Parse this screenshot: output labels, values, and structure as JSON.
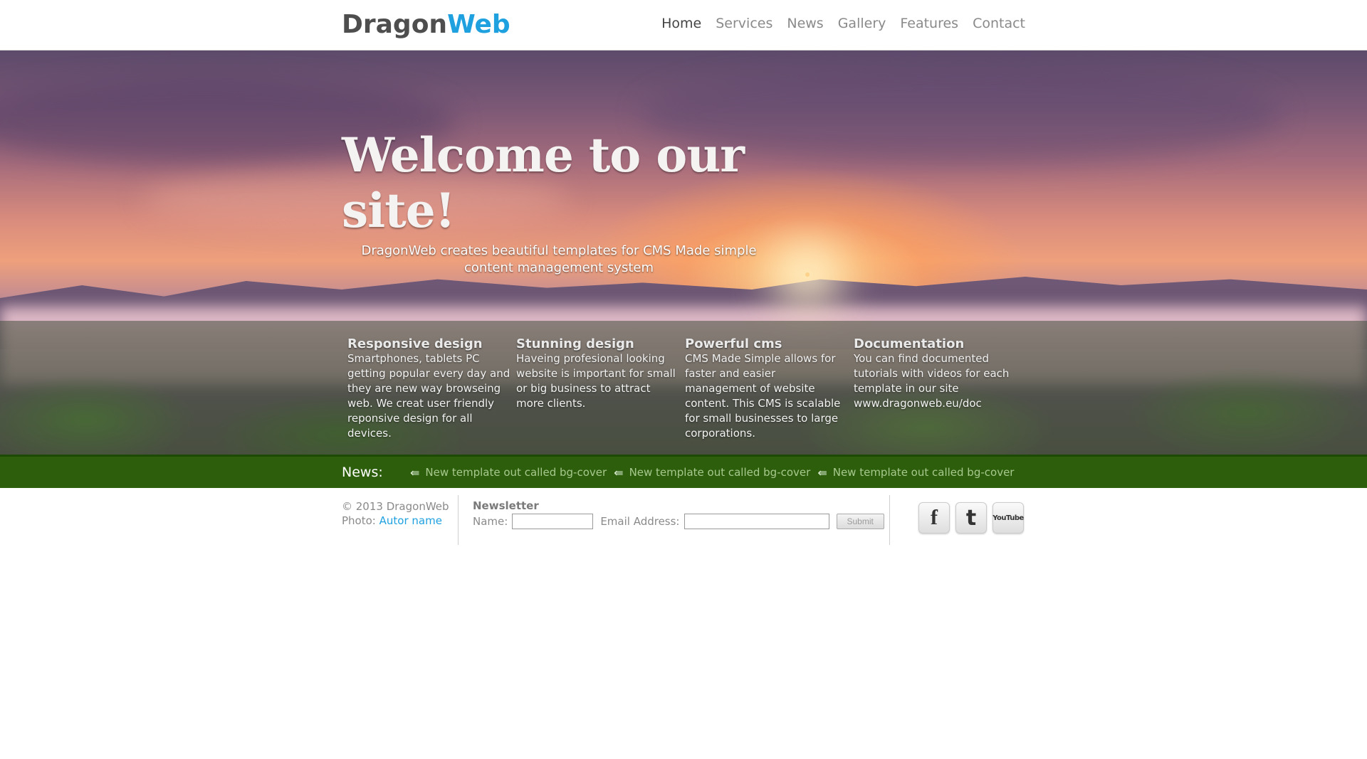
{
  "header": {
    "logo_part1": "Dragon",
    "logo_part2": "Web",
    "nav": [
      "Home",
      "Services",
      "News",
      "Gallery",
      "Features",
      "Contact"
    ]
  },
  "hero": {
    "title": "Welcome to our site!",
    "subtitle": "DragonWeb creates beautiful templates for CMS Made simple content management system"
  },
  "features": [
    {
      "title": "Responsive design",
      "text": "Smartphones, tablets PC getting popular every day and they are new way browseing web. We creat user friendly reponsive design for all devices."
    },
    {
      "title": "Stunning design",
      "text": "Haveing profesional looking website is important for small or big business to attract more clients."
    },
    {
      "title": "Powerful cms",
      "text": "CMS Made Simple allows for faster and easier management of website content. This CMS is scalable for small businesses to large corporations."
    },
    {
      "title": "Documentation",
      "text": "You can find documented tutorials with videos for each template in our site www.dragonweb.eu/doc"
    }
  ],
  "news": {
    "label": "News:",
    "items": [
      "New template out called bg-cover",
      "New template out called bg-cover",
      "New template out called bg-cover"
    ]
  },
  "footer": {
    "copyright": "© 2013 DragonWeb",
    "photo_label": "Photo:",
    "photo_author": "Autor name",
    "newsletter_title": "Newsletter",
    "name_label": "Name:",
    "email_label": "Email Address:",
    "submit_label": "Submit",
    "social": [
      "facebook-icon",
      "twitter-icon",
      "youtube-icon"
    ],
    "social_glyphs": [
      "f",
      "t",
      "YouTube"
    ]
  },
  "colors": {
    "brand_blue": "#1fa1e0",
    "news_bar": "#2c5e0c"
  }
}
